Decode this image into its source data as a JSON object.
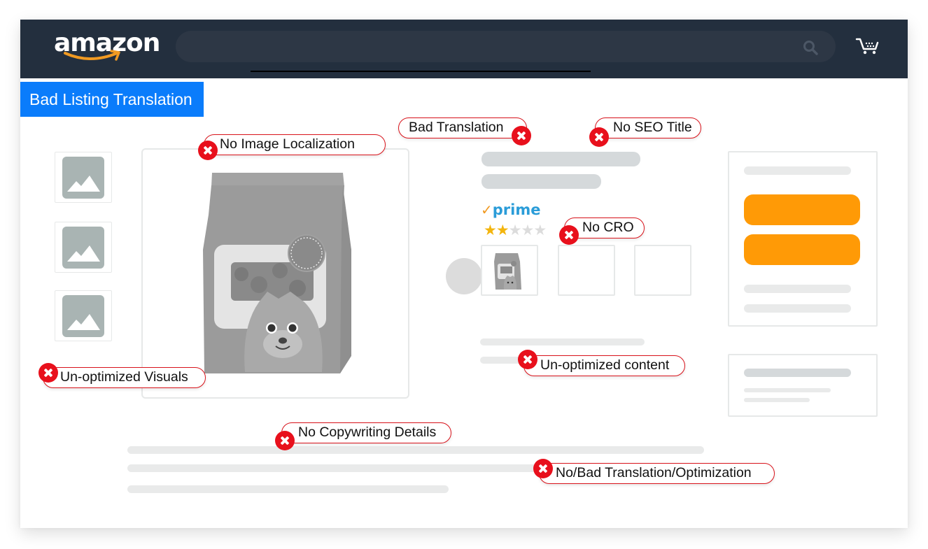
{
  "header": {
    "logo_text": "amazon",
    "logo_icon": "amazon-smile-arrow-icon",
    "search_placeholder": "",
    "search_icon": "search-icon",
    "cart_icon": "cart-icon"
  },
  "banner": {
    "title": "Bad Listing Translation",
    "color": "#0a7cfb"
  },
  "product": {
    "prime_label": "prime",
    "prime_check": "✓",
    "rating": {
      "value": 2,
      "max": 5
    },
    "star_glyph": "★"
  },
  "callouts": [
    {
      "id": "no-image-localization",
      "label": "No Image Localization"
    },
    {
      "id": "bad-translation",
      "label": "Bad Translation"
    },
    {
      "id": "no-seo-title",
      "label": "No SEO Title"
    },
    {
      "id": "no-cro",
      "label": "No CRO"
    },
    {
      "id": "un-optimized-visuals",
      "label": "Un-optimized Visuals"
    },
    {
      "id": "un-optimized-content",
      "label": "Un-optimized content"
    },
    {
      "id": "no-copywriting-details",
      "label": "No Copywriting Details"
    },
    {
      "id": "no-bad-translation-optimization",
      "label": "No/Bad Translation/Optimization"
    }
  ],
  "colors": {
    "header_bg": "#232f3e",
    "error_red": "#e8101c",
    "buy_button": "#ff9a06",
    "prime_blue": "#2a9cd8",
    "star_on": "#f3b50e",
    "placeholder_gray": "#e9eaea"
  }
}
